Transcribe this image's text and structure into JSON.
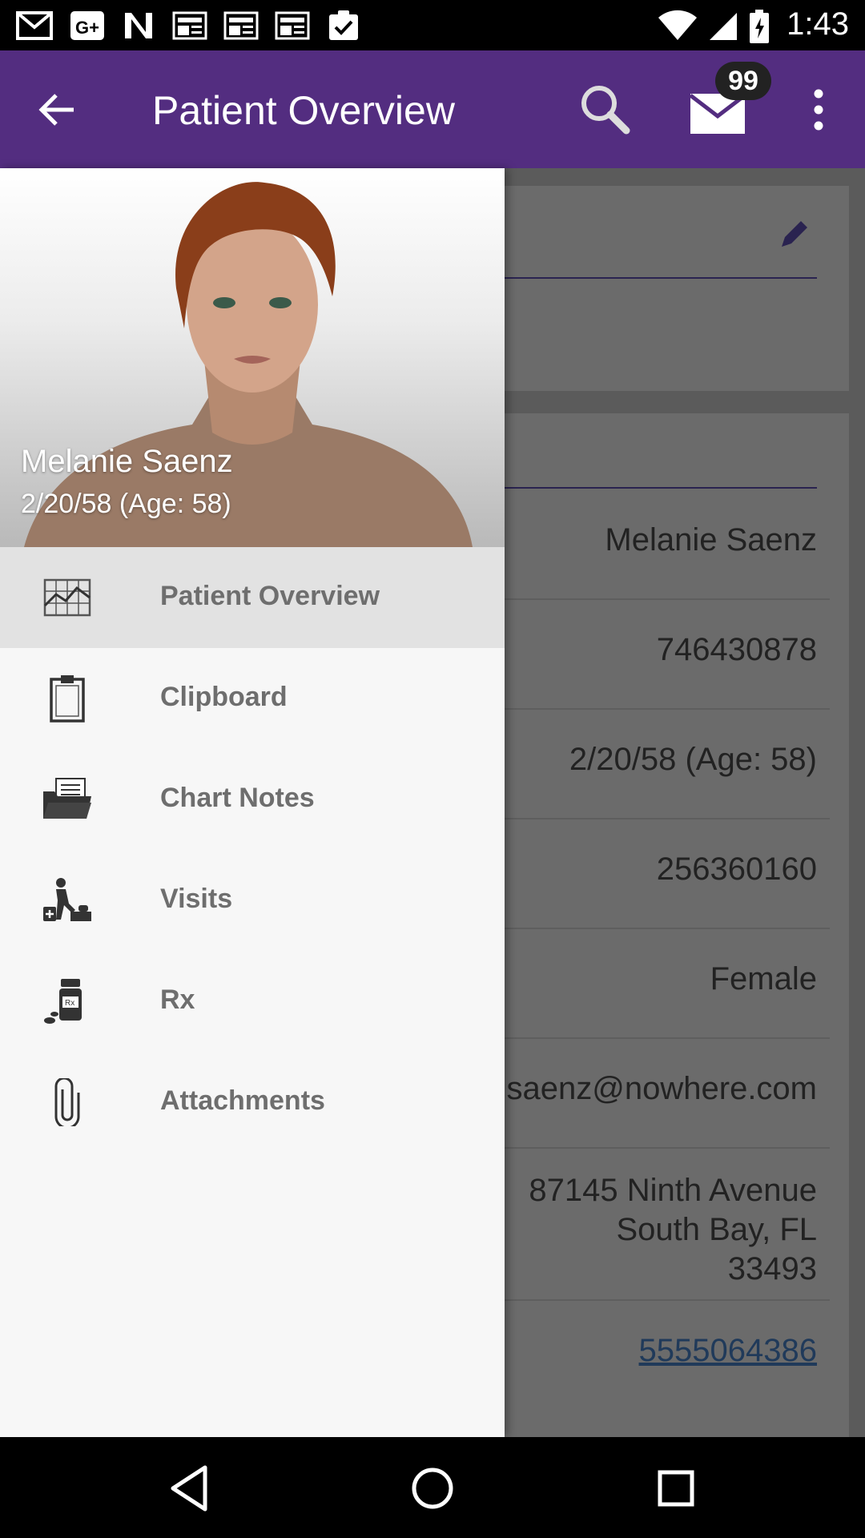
{
  "status_bar": {
    "time": "1:43",
    "notification_icons": [
      "gmail-icon",
      "google-plus-icon",
      "n-app-icon",
      "news-icon",
      "news-icon",
      "news-icon",
      "clipboard-check-icon"
    ],
    "system_icons": [
      "wifi-icon",
      "signal-icon",
      "battery-icon"
    ]
  },
  "app_bar": {
    "title": "Patient Overview",
    "mail_badge": "99",
    "color": "#532d80"
  },
  "drawer": {
    "patient_name": "Melanie Saenz",
    "patient_dob": "2/20/58 (Age: 58)",
    "items": [
      {
        "label": "Patient Overview",
        "icon": "chart-grid-icon",
        "active": true
      },
      {
        "label": "Clipboard",
        "icon": "clipboard-icon",
        "active": false
      },
      {
        "label": "Chart Notes",
        "icon": "folder-notes-icon",
        "active": false
      },
      {
        "label": "Visits",
        "icon": "visits-icon",
        "active": false
      },
      {
        "label": "Rx",
        "icon": "pill-bottle-icon",
        "active": false
      },
      {
        "label": "Attachments",
        "icon": "paperclip-icon",
        "active": false
      }
    ]
  },
  "background_fields": {
    "name": "Melanie Saenz",
    "id": "746430878",
    "dob": "2/20/58 (Age: 58)",
    "ssn": "256360160",
    "gender": "Female",
    "email_partial": "saenz@nowhere.com",
    "address": "87145 Ninth Avenue\nSouth Bay, FL\n33493",
    "phone": "5555064386"
  }
}
